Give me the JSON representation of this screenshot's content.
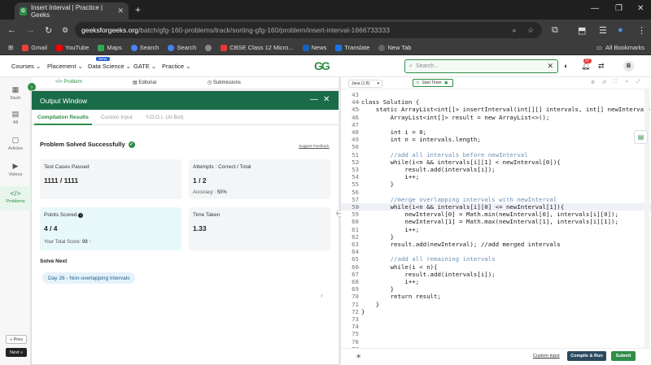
{
  "browser": {
    "tab_title": "Insert Interval | Practice | Geeks",
    "url_site": "geeksforgeeks.org",
    "url_path": "/batch/gfg-160-problems/track/sorting-gfg-160/problem/insert-interval-1666733333",
    "bookmarks": [
      {
        "label": "Gmail",
        "color": "#ea4335"
      },
      {
        "label": "YouTube",
        "color": "#ff0000"
      },
      {
        "label": "Maps",
        "color": "#34a853"
      },
      {
        "label": "Search",
        "color": "#4285f4"
      },
      {
        "label": "Search",
        "color": "#4285f4"
      },
      {
        "label": "",
        "color": "#888888"
      },
      {
        "label": "CBSE Class 12 Micro...",
        "color": "#e53935"
      },
      {
        "label": "News",
        "color": "#1565c0"
      },
      {
        "label": "Translate",
        "color": "#1a73e8"
      },
      {
        "label": "New Tab",
        "color": "#666666"
      }
    ],
    "all_bookmarks": "All Bookmarks"
  },
  "header": {
    "menus": [
      "Courses",
      "Placement",
      "Data Science",
      "GATE",
      "Practice"
    ],
    "ds_badge": "NEW",
    "logo": "GG",
    "search_placeholder": "Search...",
    "notif_count": "37",
    "avatar": "B"
  },
  "rail": {
    "items": [
      {
        "label": "Dash",
        "icon": "grid-icon"
      },
      {
        "label": "All",
        "icon": "list-icon"
      },
      {
        "label": "Articles",
        "icon": "doc-icon"
      },
      {
        "label": "Videos",
        "icon": "video-icon"
      },
      {
        "label": "Problems",
        "icon": "code-icon"
      }
    ],
    "prev": "« Prev",
    "next": "Next »"
  },
  "problem_tabs": [
    "Problem",
    "Editorial",
    "Submissions"
  ],
  "output": {
    "title": "Output Window",
    "tabs": [
      "Compilation Results",
      "Custom Input",
      "Y.O.G.I. (AI Bot)"
    ],
    "status": "Problem Solved Successfully",
    "feedback": "Suggest Feedback",
    "test_label": "Test Cases Passed",
    "test_value": "1111 / 1111",
    "attempts_label": "Attempts : Correct / Total",
    "attempts_value": "1 / 2",
    "accuracy_label": "Accuracy :",
    "accuracy_value": "50%",
    "points_label": "Points Scored",
    "points_value": "4 / 4",
    "total_label": "Your Total Score:",
    "total_value": "98",
    "time_label": "Time Taken",
    "time_value": "1.33",
    "solve_next": "Solve Next",
    "next_problem": "Day 26 - Non-overlapping Intervals"
  },
  "editor": {
    "language": "Java (1.8)",
    "timer": "Start Timer",
    "custom_input": "Custom Input",
    "run": "Compile & Run",
    "submit": "Submit",
    "lines": [
      {
        "n": "43",
        "t": ""
      },
      {
        "n": "44",
        "t": "class Solution {",
        "f": true
      },
      {
        "n": "45",
        "t": "    static ArrayList<int[]> insertInterval(int[][] intervals, int[] newInterval) {",
        "f": true
      },
      {
        "n": "46",
        "t": "        ArrayList<int[]> result = new ArrayList<>();"
      },
      {
        "n": "47",
        "t": ""
      },
      {
        "n": "48",
        "t": "        int i = 0;"
      },
      {
        "n": "49",
        "t": "        int n = intervals.length;"
      },
      {
        "n": "50",
        "t": ""
      },
      {
        "n": "51",
        "t": "        //add all intervals before newInterval"
      },
      {
        "n": "52",
        "t": "        while(i<n && intervals[i][1] < newInterval[0]){",
        "f": true
      },
      {
        "n": "53",
        "t": "            result.add(intervals[i]);"
      },
      {
        "n": "54",
        "t": "            i++;"
      },
      {
        "n": "55",
        "t": "        }"
      },
      {
        "n": "56",
        "t": ""
      },
      {
        "n": "57",
        "t": "        //merge overlapping intervals with newInterval"
      },
      {
        "n": "58",
        "t": "        while(i<n && intervals[i][0] <= newInterval[1]){",
        "f": true,
        "hl": true
      },
      {
        "n": "59",
        "t": "            newInterval[0] = Math.min(newInterval[0], intervals[i][0]);"
      },
      {
        "n": "60",
        "t": "            newInterval[1] = Math.max(newInterval[1], intervals[i][1]);"
      },
      {
        "n": "61",
        "t": "            i++;"
      },
      {
        "n": "62",
        "t": "        }"
      },
      {
        "n": "63",
        "t": "        result.add(newInterval); //add merged intervals"
      },
      {
        "n": "64",
        "t": ""
      },
      {
        "n": "65",
        "t": "        //add all remaining intervals"
      },
      {
        "n": "66",
        "t": "        while(i < n){",
        "f": true
      },
      {
        "n": "67",
        "t": "            result.add(intervals[i]);"
      },
      {
        "n": "68",
        "t": "            i++;"
      },
      {
        "n": "69",
        "t": "        }"
      },
      {
        "n": "70",
        "t": "        return result;"
      },
      {
        "n": "71",
        "t": "    }"
      },
      {
        "n": "72",
        "t": "}"
      },
      {
        "n": "73",
        "t": ""
      },
      {
        "n": "74",
        "t": ""
      },
      {
        "n": "75",
        "t": ""
      },
      {
        "n": "76",
        "t": ""
      },
      {
        "n": "77",
        "t": ""
      },
      {
        "n": "78",
        "t": ""
      }
    ]
  }
}
